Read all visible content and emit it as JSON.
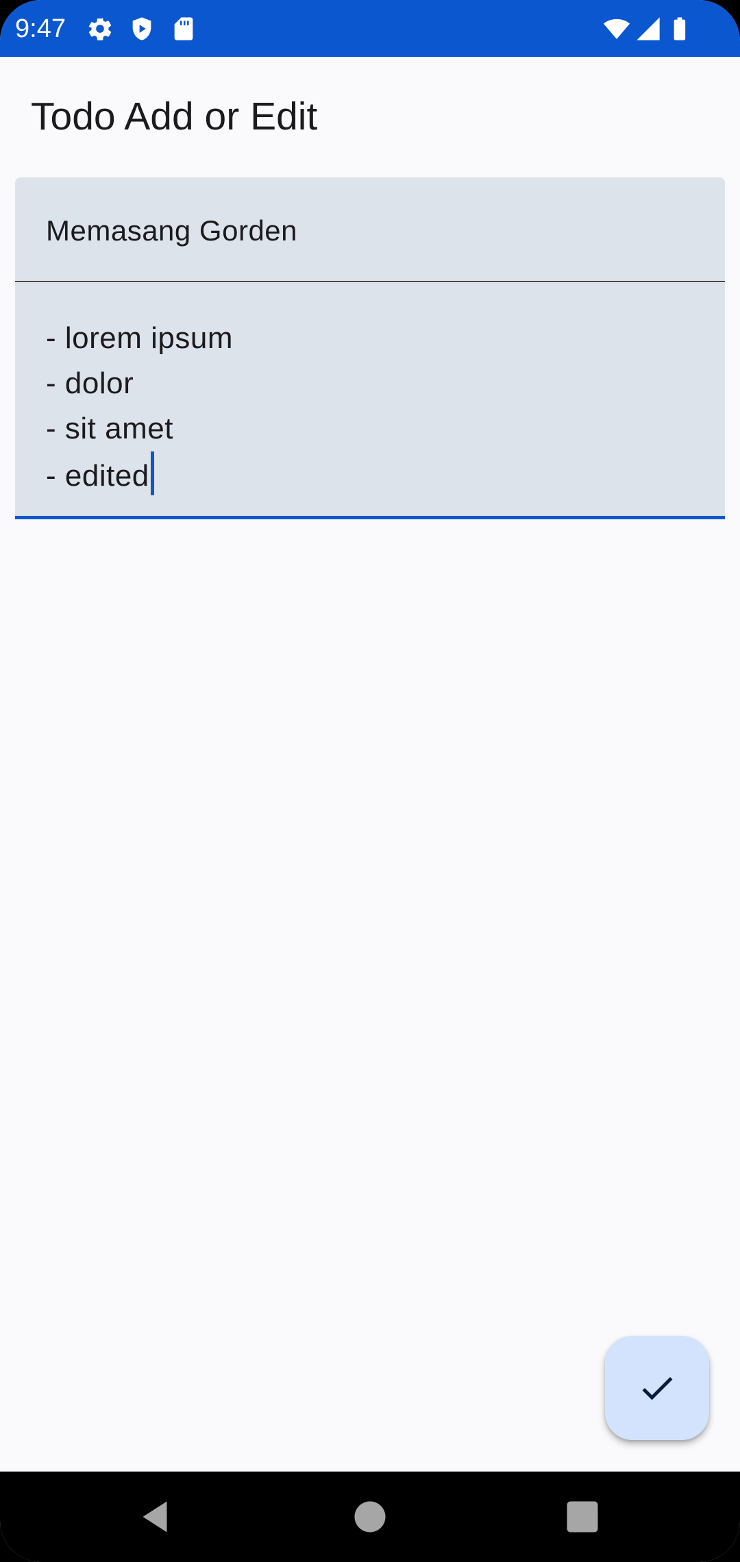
{
  "status_bar": {
    "time": "9:47",
    "left_icons": [
      "gear-icon",
      "shield-play-icon",
      "sd-card-icon"
    ],
    "right_icons": [
      "wifi-icon",
      "signal-icon",
      "battery-icon"
    ],
    "color": "#0b57d0"
  },
  "app_bar": {
    "title": "Todo Add or Edit"
  },
  "form": {
    "title_value": "Memasang Gorden",
    "body_lines": [
      "- lorem ipsum",
      "- dolor",
      "- sit amet",
      "- edited"
    ],
    "focused_field": "body"
  },
  "fab": {
    "icon": "check-icon",
    "color": "#d3e3fd"
  },
  "nav_bar": {
    "buttons": [
      "back-icon",
      "home-icon",
      "recents-icon"
    ]
  },
  "colors": {
    "accent": "#0b57d0",
    "field_background": "#dde3ea",
    "page_background": "#fafafc"
  }
}
